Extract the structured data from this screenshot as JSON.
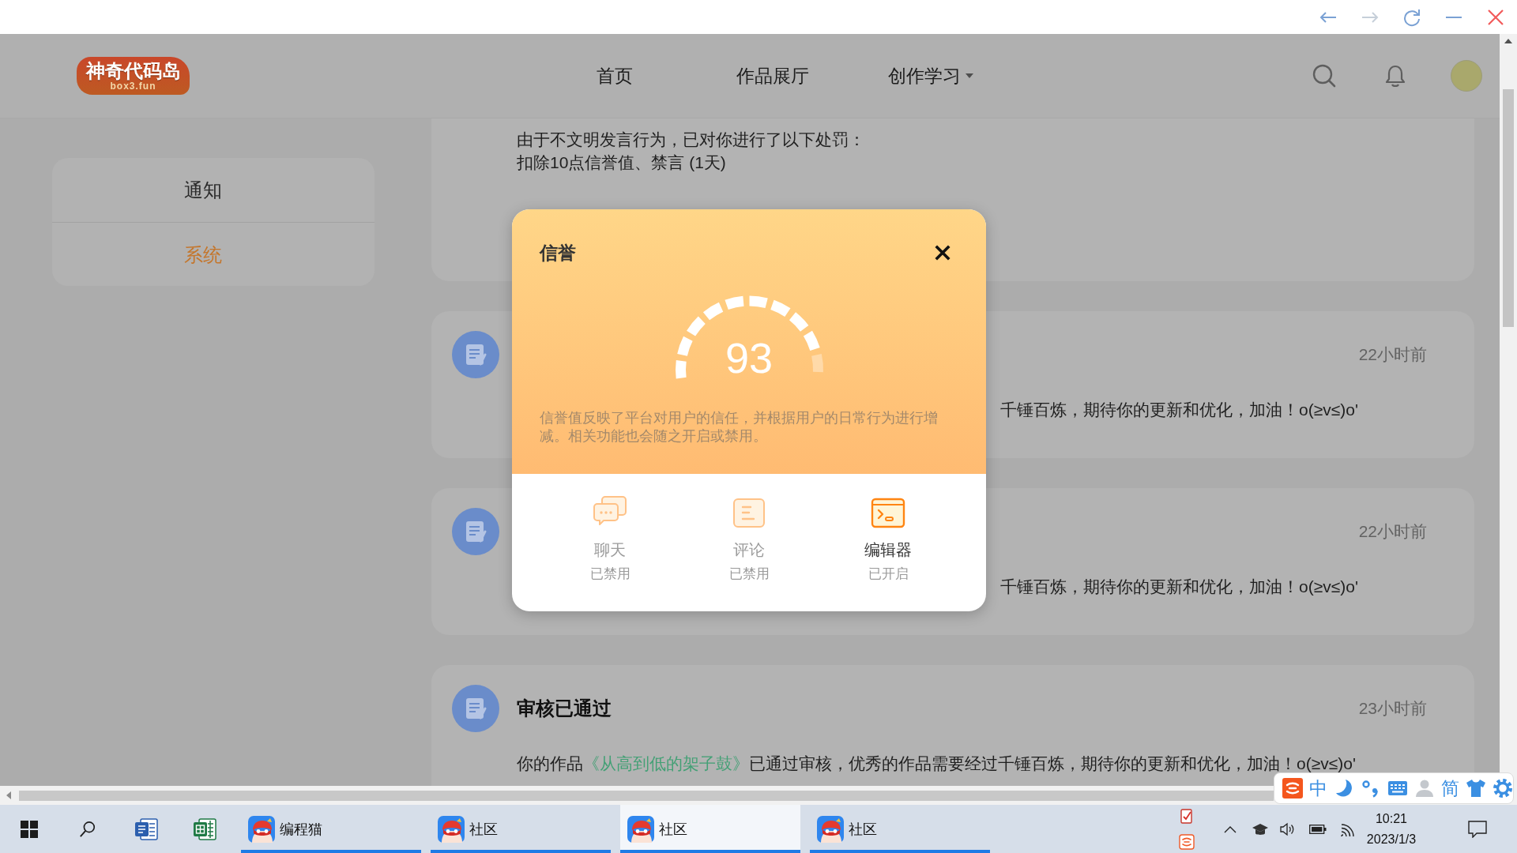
{
  "browser_bar": {
    "buttons": [
      {
        "kind": "back",
        "disabled": false
      },
      {
        "kind": "forward",
        "disabled": true
      },
      {
        "kind": "refresh",
        "disabled": false
      },
      {
        "kind": "minimize",
        "disabled": false
      },
      {
        "kind": "close",
        "disabled": false
      }
    ]
  },
  "header": {
    "logo": {
      "title": "神奇代码岛",
      "subtitle": "box3.fun"
    },
    "nav": [
      {
        "label": "首页",
        "dropdown": false
      },
      {
        "label": "作品展厅",
        "dropdown": false
      },
      {
        "label": "创作学习",
        "dropdown": true
      }
    ]
  },
  "sidebar": {
    "items": [
      {
        "label": "通知",
        "selected": false
      },
      {
        "label": "系统",
        "selected": true
      }
    ]
  },
  "messages": [
    {
      "kind": "cut-off",
      "paragraphs": [
        [
          "由于不文明发言行为，已对你进行了以下处罚：",
          "扣除10点信誉值、禁言 (1天)"
        ]
      ]
    },
    {
      "kind": "covered",
      "time": "22小时前",
      "body": [
        {
          "text": "千锤百炼，期待你的更新和优化，加油！o(≥v≤)o'",
          "link": false
        }
      ]
    },
    {
      "kind": "covered",
      "time": "22小时前",
      "body": [
        {
          "text": "千锤百炼，期待你的更新和优化，加油！o(≥v≤)o'",
          "link": false
        }
      ]
    },
    {
      "kind": "full",
      "title": "审核已通过",
      "time": "23小时前",
      "body": [
        {
          "text": "你的作品",
          "link": false
        },
        {
          "text": "《从高到低的架子鼓》",
          "link": true
        },
        {
          "text": "已通过审核，优秀的作品需要经过千锤百炼，期待你的更新和优化，加油！o(≥v≤)o'",
          "link": false
        }
      ]
    }
  ],
  "credit_dialog": {
    "title": "信誉",
    "score": "93",
    "level": 0.93,
    "description": "信誉值反映了平台对用户的信任，并根据用户的日常行为进行增减。相关功能也会随之开启或禁用。",
    "features": [
      {
        "kind": "chat",
        "label": "聊天",
        "status": "已禁用",
        "enabled": false
      },
      {
        "kind": "comment",
        "label": "评论",
        "status": "已禁用",
        "enabled": false
      },
      {
        "kind": "editor",
        "label": "编辑器",
        "status": "已开启",
        "enabled": true
      }
    ]
  },
  "ime_toolbar": {
    "mode": "中",
    "script": "简"
  },
  "taskbar": {
    "windows": [
      {
        "label": "编程猫",
        "selected": false
      },
      {
        "label": "社区",
        "selected": false
      },
      {
        "label": "社区",
        "selected": true
      },
      {
        "label": "社区",
        "selected": false
      }
    ],
    "clock": {
      "time": "10:21",
      "date": "2023/1/3"
    }
  }
}
